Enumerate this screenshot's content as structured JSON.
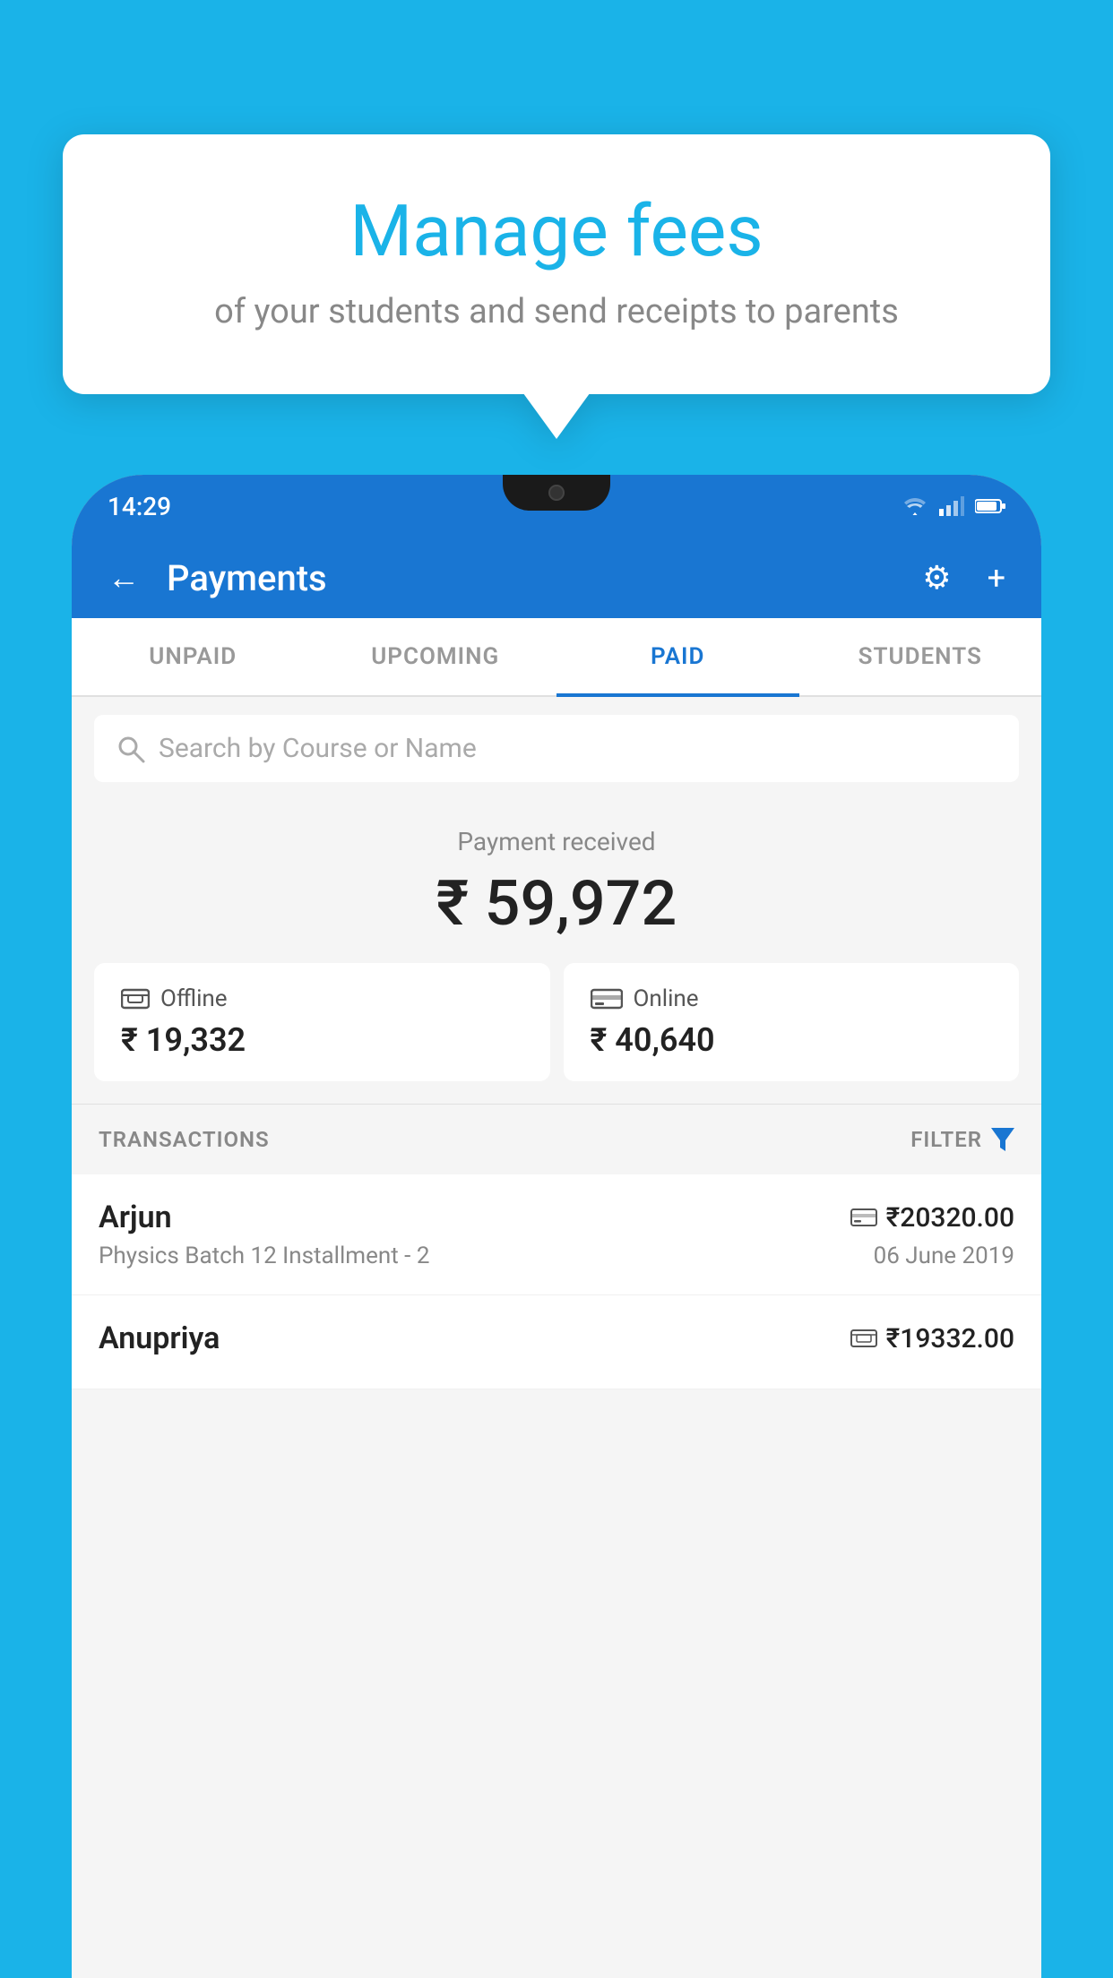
{
  "background_color": "#1ab3e8",
  "tooltip": {
    "title": "Manage fees",
    "subtitle": "of your students and send receipts to parents"
  },
  "status_bar": {
    "time": "14:29",
    "icons": [
      "wifi",
      "signal",
      "battery"
    ]
  },
  "header": {
    "title": "Payments",
    "back_label": "←",
    "settings_label": "⚙",
    "add_label": "+"
  },
  "tabs": [
    {
      "label": "UNPAID",
      "active": false
    },
    {
      "label": "UPCOMING",
      "active": false
    },
    {
      "label": "PAID",
      "active": true
    },
    {
      "label": "STUDENTS",
      "active": false
    }
  ],
  "search": {
    "placeholder": "Search by Course or Name"
  },
  "payment_summary": {
    "label": "Payment received",
    "amount": "₹ 59,972",
    "offline": {
      "icon": "💳",
      "label": "Offline",
      "amount": "₹ 19,332"
    },
    "online": {
      "icon": "💳",
      "label": "Online",
      "amount": "₹ 40,640"
    }
  },
  "transactions": {
    "label": "TRANSACTIONS",
    "filter_label": "FILTER",
    "items": [
      {
        "name": "Arjun",
        "amount": "₹20320.00",
        "course": "Physics Batch 12 Installment - 2",
        "date": "06 June 2019",
        "pay_type": "online"
      },
      {
        "name": "Anupriya",
        "amount": "₹19332.00",
        "course": "",
        "date": "",
        "pay_type": "offline"
      }
    ]
  }
}
